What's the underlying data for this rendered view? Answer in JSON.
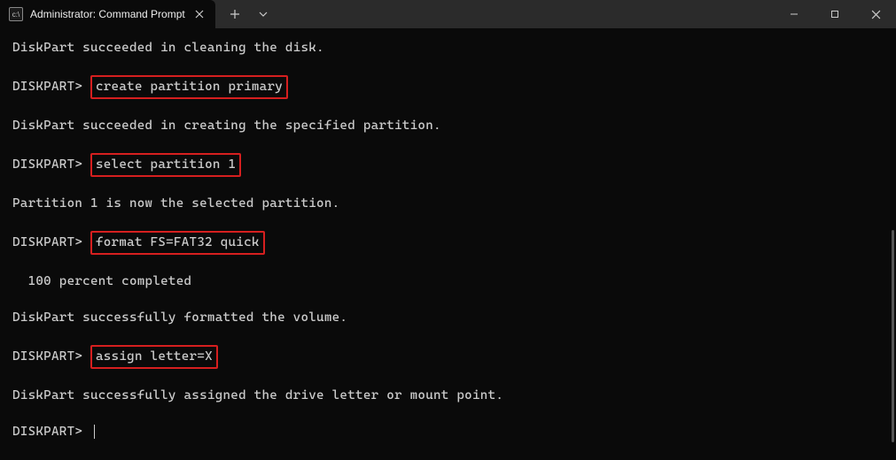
{
  "window": {
    "tab_title": "Administrator: Command Prompt",
    "minimize_tooltip": "Minimize",
    "maximize_tooltip": "Maximize",
    "close_tooltip": "Close"
  },
  "terminal": {
    "lines": [
      {
        "type": "output",
        "text": "DiskPart succeeded in cleaning the disk."
      },
      {
        "type": "prompt",
        "prompt": "DISKPART>",
        "command": "create partition primary",
        "highlight": true
      },
      {
        "type": "output",
        "text": "DiskPart succeeded in creating the specified partition."
      },
      {
        "type": "prompt",
        "prompt": "DISKPART>",
        "command": "select partition 1",
        "highlight": true
      },
      {
        "type": "output",
        "text": "Partition 1 is now the selected partition."
      },
      {
        "type": "prompt",
        "prompt": "DISKPART>",
        "command": "format FS=FAT32 quick",
        "highlight": true
      },
      {
        "type": "output",
        "text": "  100 percent completed"
      },
      {
        "type": "output",
        "text": "DiskPart successfully formatted the volume."
      },
      {
        "type": "prompt",
        "prompt": "DISKPART>",
        "command": "assign letter=X",
        "highlight": true
      },
      {
        "type": "output",
        "text": "DiskPart successfully assigned the drive letter or mount point."
      },
      {
        "type": "prompt",
        "prompt": "DISKPART>",
        "command": "",
        "cursor": true
      }
    ]
  }
}
